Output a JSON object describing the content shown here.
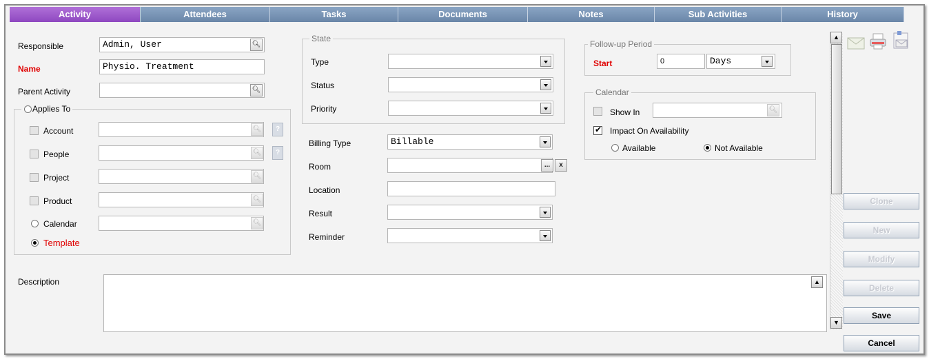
{
  "tabs": [
    {
      "label": "Activity"
    },
    {
      "label": "Attendees"
    },
    {
      "label": "Tasks"
    },
    {
      "label": "Documents"
    },
    {
      "label": "Notes"
    },
    {
      "label": "Sub Activities"
    },
    {
      "label": "History"
    }
  ],
  "left": {
    "responsible_label": "Responsible",
    "responsible_value": "Admin, User",
    "name_label": "Name",
    "name_value": "Physio. Treatment",
    "parent_label": "Parent Activity",
    "parent_value": "",
    "applies_to_label": "Applies To",
    "applies": [
      {
        "label": "Account",
        "value": ""
      },
      {
        "label": "People",
        "value": ""
      },
      {
        "label": "Project",
        "value": ""
      },
      {
        "label": "Product",
        "value": ""
      }
    ],
    "calendar_label": "Calendar",
    "calendar_value": "",
    "template_label": "Template"
  },
  "state": {
    "legend": "State",
    "type_label": "Type",
    "type_value": "",
    "status_label": "Status",
    "status_value": "",
    "priority_label": "Priority",
    "priority_value": ""
  },
  "middle": {
    "billing_label": "Billing Type",
    "billing_value": "Billable",
    "room_label": "Room",
    "room_value": "",
    "room_browse": "...",
    "room_clear": "x",
    "location_label": "Location",
    "location_value": "",
    "result_label": "Result",
    "result_value": "",
    "reminder_label": "Reminder",
    "reminder_value": ""
  },
  "followup": {
    "legend": "Follow-up Period",
    "start_label": "Start",
    "start_value": "0",
    "unit_value": "Days"
  },
  "calendar_group": {
    "legend": "Calendar",
    "show_in_label": "Show In",
    "show_in_value": "",
    "impact_label": "Impact On Availability",
    "available_label": "Available",
    "not_available_label": "Not Available"
  },
  "description": {
    "label": "Description",
    "value": ""
  },
  "help_glyph": "?",
  "buttons": {
    "clone": "Clone",
    "new": "New",
    "modify": "Modify",
    "delete": "Delete",
    "save": "Save",
    "cancel": "Cancel"
  },
  "colors": {
    "active_tab": "#9a58cc",
    "tab": "#7a96b8",
    "required_label": "#e00000"
  }
}
